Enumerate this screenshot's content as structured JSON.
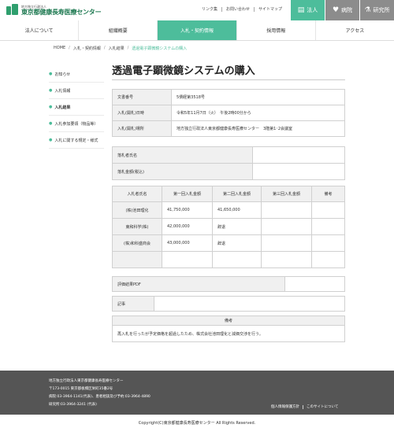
{
  "header": {
    "logo_sub": "地方独立行政法人",
    "logo_main": "東京都健康長寿医療センター",
    "util_links": [
      "リンク集",
      "お問い合わせ",
      "サイトマップ"
    ],
    "site_tabs": [
      {
        "label": "法人",
        "icon": "building-icon"
      },
      {
        "label": "病院",
        "icon": "heart-icon"
      },
      {
        "label": "研究所",
        "icon": "flask-icon"
      }
    ]
  },
  "gnav": [
    "法人について",
    "組織概要",
    "入札・契約情報",
    "採用情報",
    "アクセス"
  ],
  "breadcrumb": [
    "HOME",
    "入札・契約情報",
    "入札結果",
    "透過電子顕微鏡システムの購入"
  ],
  "sidebar": [
    "お知らせ",
    "入札情報",
    "入札結果",
    "入札参加要領（物品等）",
    "入札に関する規定・様式"
  ],
  "page_title": "透過電子顕微鏡システムの購入",
  "info_table": [
    {
      "label": "文書番号",
      "value": "5債経第3518号"
    },
    {
      "label": "入札(開札)日時",
      "value": "令和5年11月7日（火）　午後2時00分から"
    },
    {
      "label": "入札(開札)場所",
      "value": "地方独立行政法人東京都健康長寿医療センター　3階第1･2会議室"
    }
  ],
  "winner_table": [
    {
      "label": "落札者氏名",
      "value": ""
    },
    {
      "label": "落札金額(税込)",
      "value": ""
    }
  ],
  "bid_table": {
    "headers": [
      "入札者氏名",
      "第一回入札金額",
      "第二回入札金額",
      "第三回入札金額",
      "備考"
    ],
    "rows": [
      [
        "(株)池田理化",
        "41,750,000",
        "41,650,000",
        "",
        ""
      ],
      [
        "東和科学(株)",
        "42,000,000",
        "辞退",
        "",
        ""
      ],
      [
        "(株)和科盛商会",
        "43,000,000",
        "辞退",
        "",
        ""
      ],
      [
        "",
        "",
        "",
        "",
        ""
      ]
    ]
  },
  "pdf_label": "評価結果PDF",
  "memo_label": "記事",
  "remarks_header": "備考",
  "remarks_text": "再入札を行ったが予定価格を超過したため、株式会社池田理化と減価交渉を行う。",
  "footer": {
    "lines": [
      "地方独立行政法人東京都健康長寿医療センター",
      "〒173-0015 東京都板橋区栄町35番2号",
      "病院:03-3964-1141(代表)、患者相談及び予約:03-3964-4890",
      "研究所:03-3964-3241 (代表)"
    ],
    "links": [
      "個人情報保護方針",
      "このサイトについて"
    ]
  },
  "copyright": "Copyright(C)東京都健康長寿医療センター All Rights Reserved."
}
